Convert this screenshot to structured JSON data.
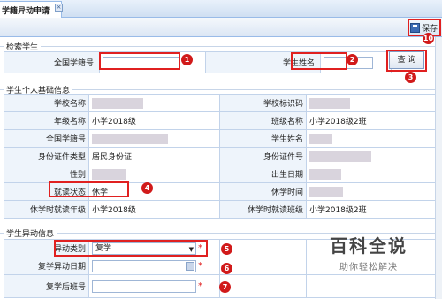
{
  "tab": {
    "title": "学籍异动申请",
    "close_glyph": "×"
  },
  "toolbar": {
    "save_label": "保存"
  },
  "search": {
    "section_title": "检索学生",
    "national_id_label": "全国学籍号:",
    "student_name_label": "学生姓名:",
    "search_button": "查 询"
  },
  "basic": {
    "section_title": "学生个人基础信息",
    "rows": [
      {
        "l1": "学校名称",
        "v1": "",
        "l2": "学校标识码",
        "v2": ""
      },
      {
        "l1": "年级名称",
        "v1": "小学2018级",
        "l2": "班级名称",
        "v2": "小学2018级2班"
      },
      {
        "l1": "全国学籍号",
        "v1": "",
        "l2": "学生姓名",
        "v2": ""
      },
      {
        "l1": "身份证件类型",
        "v1": "居民身份证",
        "l2": "身份证件号",
        "v2": ""
      },
      {
        "l1": "性别",
        "v1": "",
        "l2": "出生日期",
        "v2": ""
      },
      {
        "l1": "就读状态",
        "v1": "休学",
        "l2": "休学时间",
        "v2": ""
      },
      {
        "l1": "休学时就读年级",
        "v1": "小学2018级",
        "l2": "休学时就读班级",
        "v2": "小学2018级2班"
      }
    ]
  },
  "change": {
    "section_title": "学生异动信息",
    "type_label": "异动类别",
    "type_value": "复学",
    "date_label": "复学异动日期",
    "class_label": "复学后班号",
    "required_mark": "*"
  },
  "markers": [
    "1",
    "2",
    "3",
    "4",
    "5",
    "6",
    "7",
    "10"
  ],
  "watermark": {
    "big": "百科全说",
    "small": "助你轻松解决"
  }
}
